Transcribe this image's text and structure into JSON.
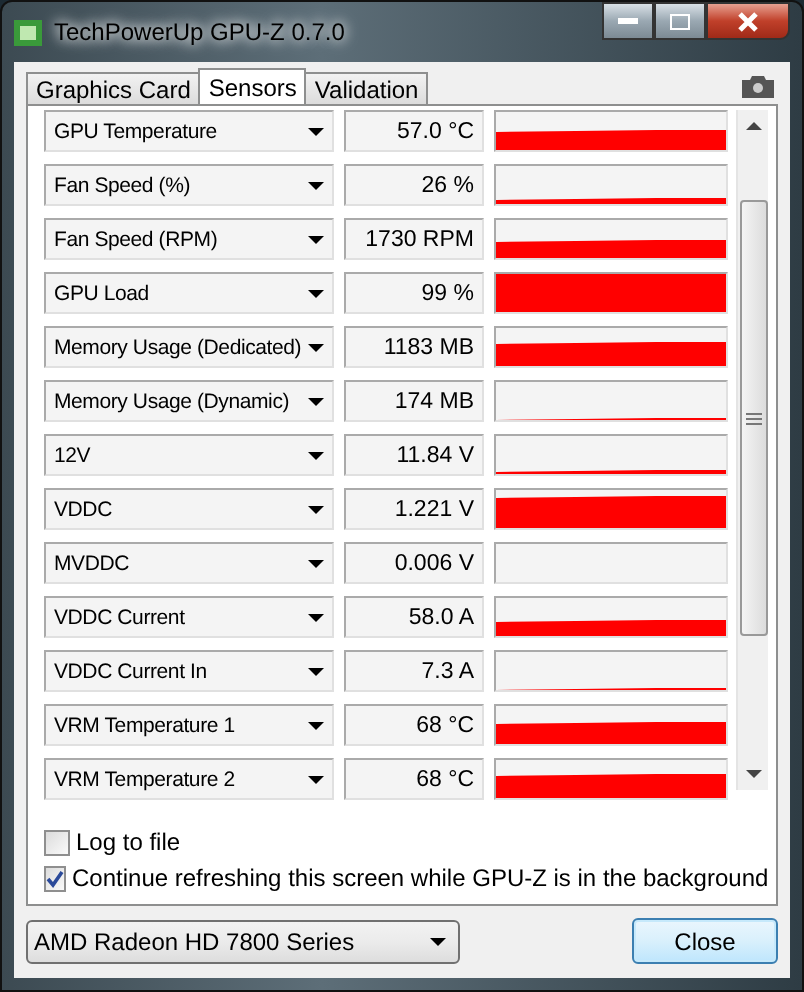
{
  "window": {
    "title": "TechPowerUp GPU-Z 0.7.0"
  },
  "tabs": [
    {
      "label": "Graphics Card",
      "selected": false
    },
    {
      "label": "Sensors",
      "selected": true
    },
    {
      "label": "Validation",
      "selected": false
    }
  ],
  "sensors": [
    {
      "name": "GPU Temperature",
      "value": "57.0 °C"
    },
    {
      "name": "Fan Speed (%)",
      "value": "26 %"
    },
    {
      "name": "Fan Speed (RPM)",
      "value": "1730 RPM"
    },
    {
      "name": "GPU Load",
      "value": "99 %"
    },
    {
      "name": "Memory Usage (Dedicated)",
      "value": "1183 MB"
    },
    {
      "name": "Memory Usage (Dynamic)",
      "value": "174 MB"
    },
    {
      "name": "12V",
      "value": "11.84 V"
    },
    {
      "name": "VDDC",
      "value": "1.221 V"
    },
    {
      "name": "MVDDC",
      "value": "0.006 V"
    },
    {
      "name": "VDDC Current",
      "value": "58.0 A"
    },
    {
      "name": "VDDC Current In",
      "value": "7.3 A"
    },
    {
      "name": "VRM Temperature 1",
      "value": "68 °C"
    },
    {
      "name": "VRM Temperature 2",
      "value": "68 °C"
    }
  ],
  "options": [
    {
      "label": "Log to file",
      "checked": false
    },
    {
      "label": "Continue refreshing this screen while GPU-Z is in the background",
      "checked": true
    }
  ],
  "device": {
    "value": "AMD Radeon HD 7800 Series"
  },
  "buttons": [
    {
      "label": "Close"
    }
  ]
}
